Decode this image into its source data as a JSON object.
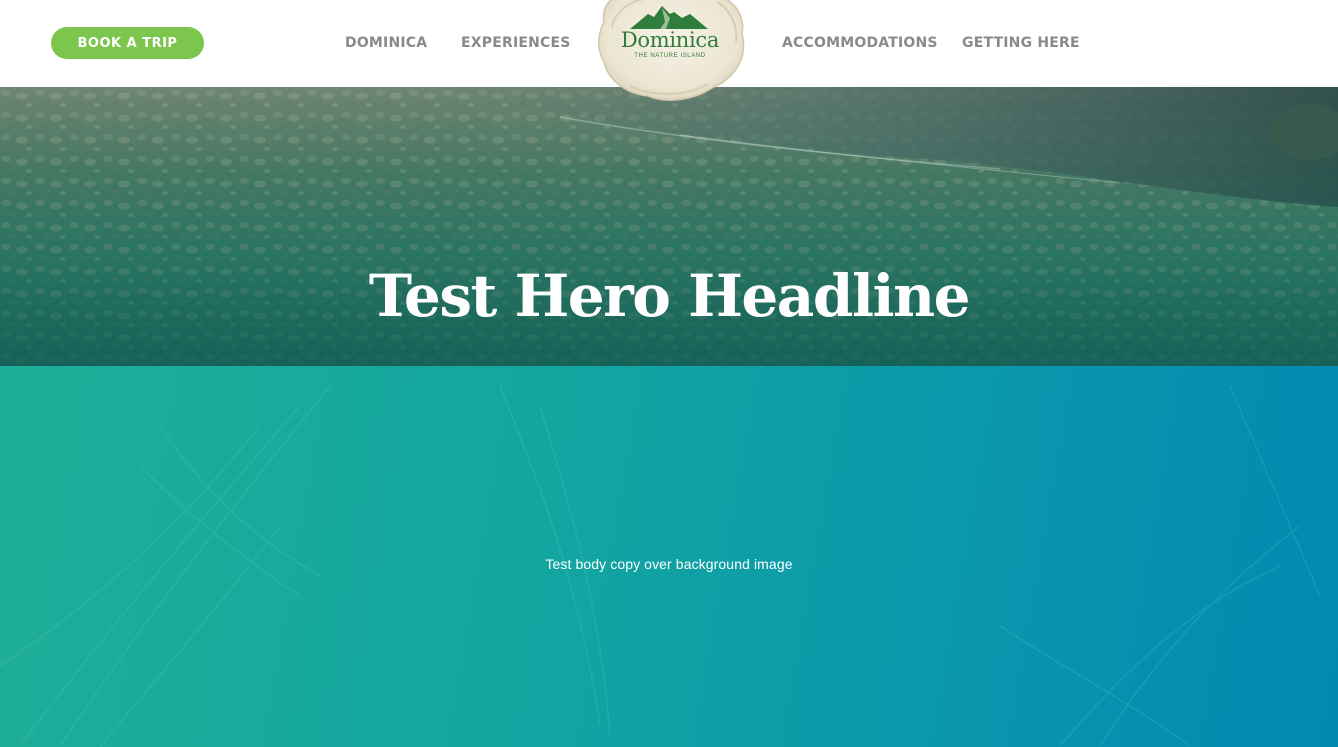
{
  "header": {
    "book_button": "BOOK A TRIP",
    "nav": {
      "dominica": "DOMINICA",
      "experiences": "EXPERIENCES",
      "accommodations": "ACCOMMODATIONS",
      "getting_here": "GETTING HERE"
    },
    "logo": {
      "wordmark": "Dominica",
      "tagline": "THE NATURE ISLAND"
    }
  },
  "hero": {
    "headline": "Test Hero Headline"
  },
  "body": {
    "copy": "Test body copy over background image"
  },
  "colors": {
    "brand_green": "#7dc64e",
    "logo_green": "#2f7d3c",
    "nav_gray": "#8a8a8a",
    "teal": "#12a6a0",
    "blue": "#0388b2"
  },
  "icons": [
    "mountain-logo-icon"
  ]
}
